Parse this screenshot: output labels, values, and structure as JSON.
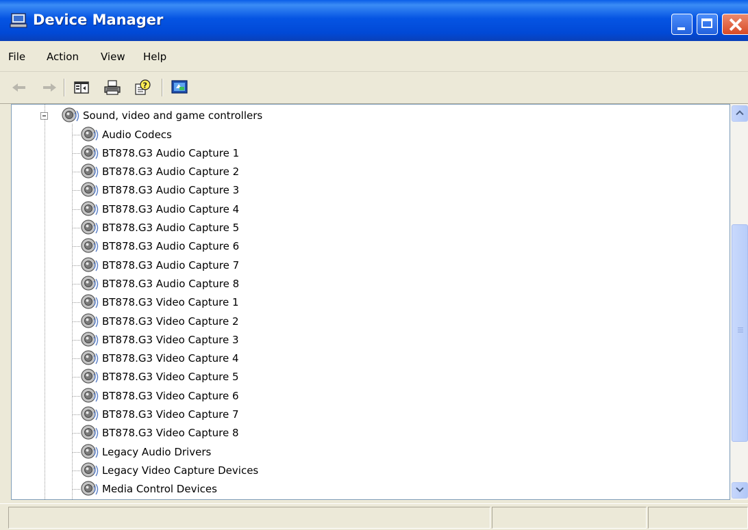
{
  "window": {
    "title": "Device Manager"
  },
  "menu": {
    "file": "File",
    "action": "Action",
    "view": "View",
    "help": "Help"
  },
  "toolbar": {
    "icons": [
      "back-arrow-icon",
      "forward-arrow-icon",
      "show-hide-console-tree-icon",
      "print-icon",
      "help-icon",
      "scan-hardware-icon"
    ]
  },
  "tree": {
    "category": {
      "label": "Sound, video and game controllers",
      "expanded": true
    },
    "items": [
      "Audio Codecs",
      "BT878.G3 Audio Capture 1",
      "BT878.G3 Audio Capture 2",
      "BT878.G3 Audio Capture 3",
      "BT878.G3 Audio Capture 4",
      "BT878.G3 Audio Capture 5",
      "BT878.G3 Audio Capture 6",
      "BT878.G3 Audio Capture 7",
      "BT878.G3 Audio Capture 8",
      "BT878.G3 Video Capture 1",
      "BT878.G3 Video Capture 2",
      "BT878.G3 Video Capture 3",
      "BT878.G3 Video Capture 4",
      "BT878.G3 Video Capture 5",
      "BT878.G3 Video Capture 6",
      "BT878.G3 Video Capture 7",
      "BT878.G3 Video Capture 8",
      "Legacy Audio Drivers",
      "Legacy Video Capture Devices",
      "Media Control Devices"
    ]
  },
  "scrollbar": {
    "position": 0.72
  },
  "colors": {
    "titlebar": "#0554e3",
    "chrome": "#ece9d8",
    "close_button": "#d84a25"
  }
}
